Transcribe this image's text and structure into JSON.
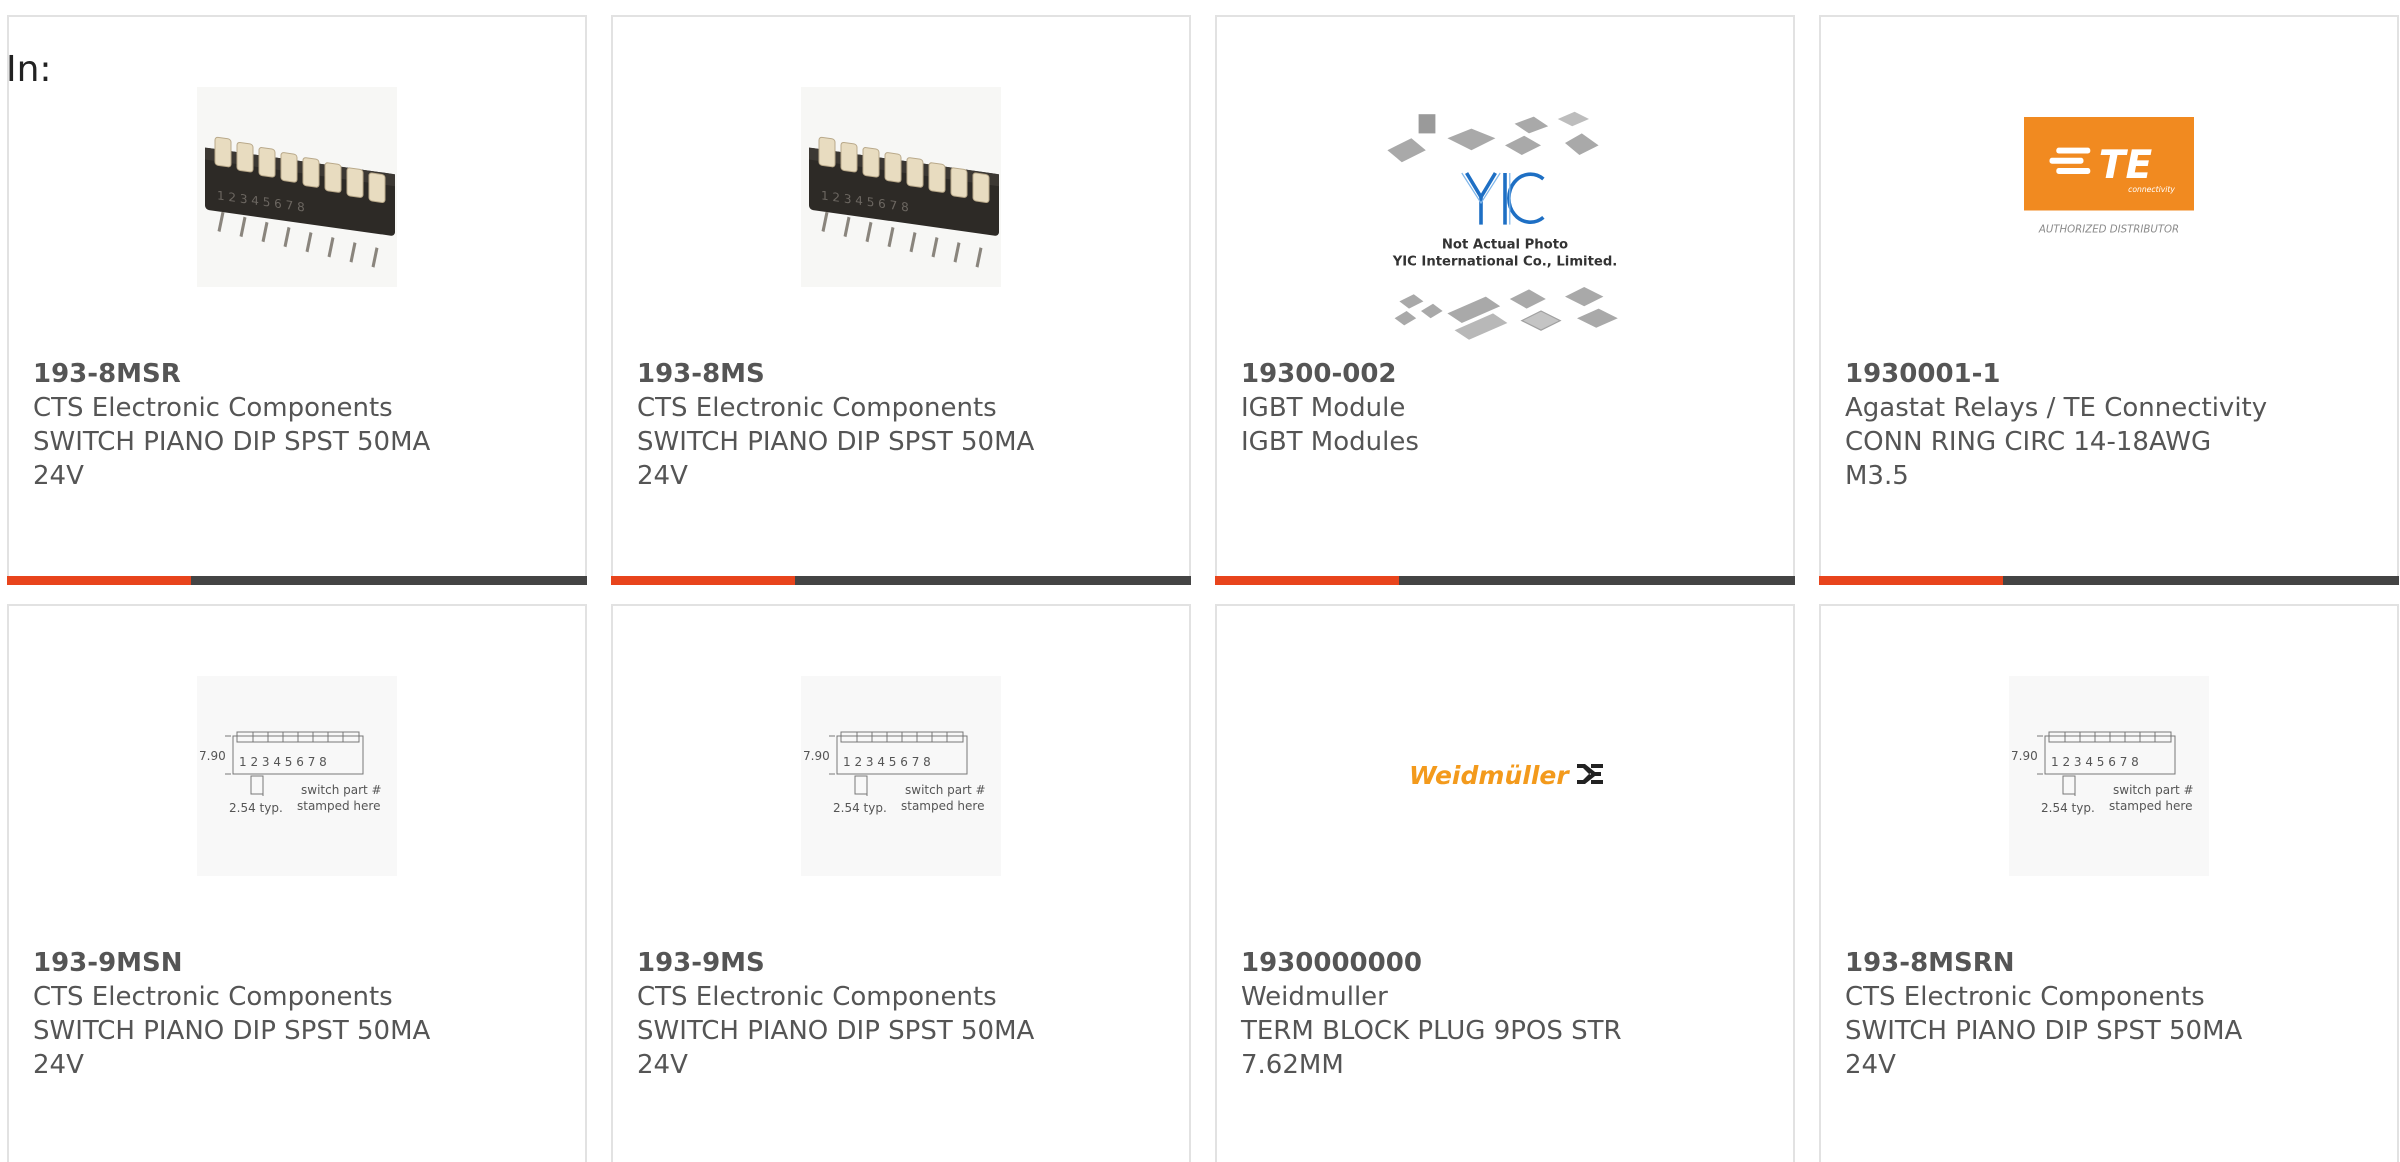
{
  "filter_label": "In:",
  "accent_color": "#e8441c",
  "products": [
    {
      "part_number": "193-8MSR",
      "manufacturer": "CTS Electronic Components",
      "description": "SWITCH PIANO DIP SPST 50MA 24V",
      "image": "dip-switch-photo"
    },
    {
      "part_number": "193-8MS",
      "manufacturer": "CTS Electronic Components",
      "description": "SWITCH PIANO DIP SPST 50MA 24V",
      "image": "dip-switch-photo"
    },
    {
      "part_number": "19300-002",
      "manufacturer": "IGBT Module",
      "description": "IGBT Modules",
      "image": "yic-placeholder",
      "image_caption_1": "Not Actual Photo",
      "image_caption_2": "YIC International Co., Limited."
    },
    {
      "part_number": "1930001-1",
      "manufacturer": "Agastat Relays / TE Connectivity",
      "description": "CONN RING CIRC 14-18AWG M3.5",
      "image": "te-logo",
      "image_caption_1": "AUTHORIZED DISTRIBUTOR"
    },
    {
      "part_number": "193-9MSN",
      "manufacturer": "CTS Electronic Components",
      "description": "SWITCH PIANO DIP SPST 50MA 24V",
      "image": "dip-switch-drawing"
    },
    {
      "part_number": "193-9MS",
      "manufacturer": "CTS Electronic Components",
      "description": "SWITCH PIANO DIP SPST 50MA 24V",
      "image": "dip-switch-drawing"
    },
    {
      "part_number": "1930000000",
      "manufacturer": "Weidmuller",
      "description": "TERM BLOCK PLUG 9POS STR 7.62MM",
      "image": "weidmuller-logo"
    },
    {
      "part_number": "193-8MSRN",
      "manufacturer": "CTS Electronic Components",
      "description": "SWITCH PIANO DIP SPST 50MA 24V",
      "image": "dip-switch-drawing"
    }
  ],
  "drawing_labels": {
    "height": "7.90",
    "numbers": "1 2 3 4 5 6 7 8",
    "pitch": "2.54 typ.",
    "note_1": "switch part #",
    "note_2": "stamped here"
  },
  "logos": {
    "te": "TE",
    "te_sub": "connectivity",
    "weidmuller": "Weidmüller"
  }
}
